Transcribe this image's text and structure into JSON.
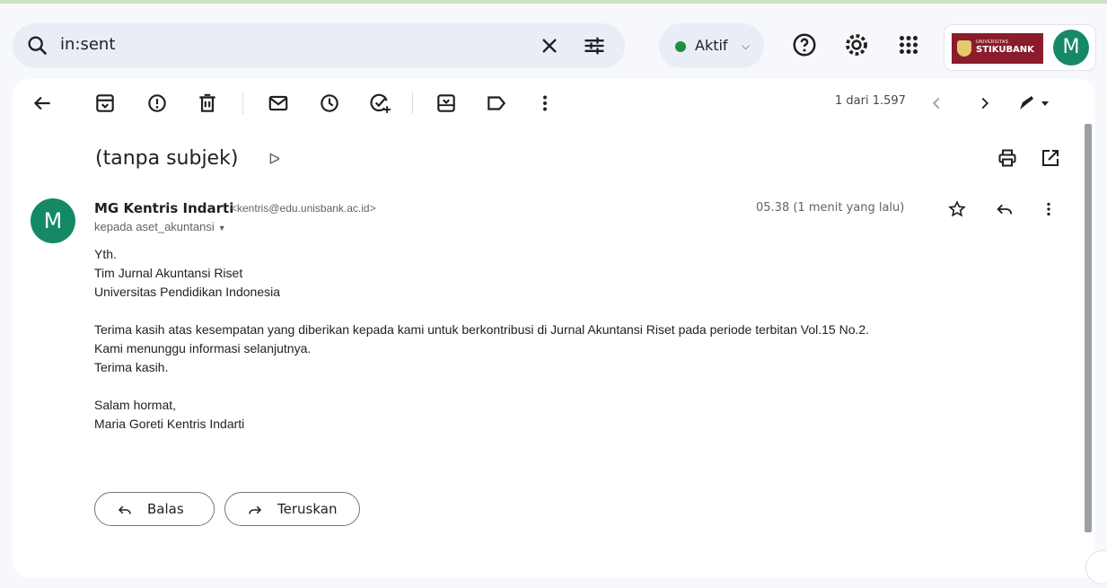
{
  "search": {
    "query": "in:sent"
  },
  "status": {
    "label": "Aktif",
    "color": "#1e8e3e"
  },
  "account": {
    "avatar_letter": "M",
    "school_top": "UNIVERSITAS",
    "school_name": "STIKUBANK"
  },
  "toolbar": {
    "icons": [
      "back-arrow-icon",
      "archive-icon",
      "report-spam-icon",
      "delete-icon",
      "mark-unread-icon",
      "snooze-icon",
      "add-task-icon",
      "move-to-icon",
      "label-icon",
      "more-vert-icon"
    ],
    "pager": "1 dari 1.597"
  },
  "email": {
    "subject": "(tanpa subjek)",
    "sender_name": "MG Kentris Indarti",
    "sender_email": "<kentris@edu.unisbank.ac.id>",
    "to": "kepada aset_akuntansi",
    "time": "05.38 (1 menit yang lalu)",
    "avatar_letter": "M",
    "body": {
      "l1": "Yth.",
      "l2": "Tim Jurnal Akuntansi Riset",
      "l3": "Universitas Pendidikan Indonesia",
      "l4": "Terima kasih atas kesempatan yang diberikan kepada kami untuk berkontribusi di Jurnal Akuntansi Riset pada periode terbitan Vol.15 No.2.",
      "l5": "Kami menunggu informasi selanjutnya.",
      "l6": "Terima kasih.",
      "l7": "Salam hormat,",
      "l8": "Maria Goreti Kentris Indarti"
    }
  },
  "actions": {
    "reply": "Balas",
    "forward": "Teruskan"
  },
  "colors": {
    "avatar": "#158966",
    "brand": "#8a1c2b",
    "search_bg": "#e9eef6"
  }
}
